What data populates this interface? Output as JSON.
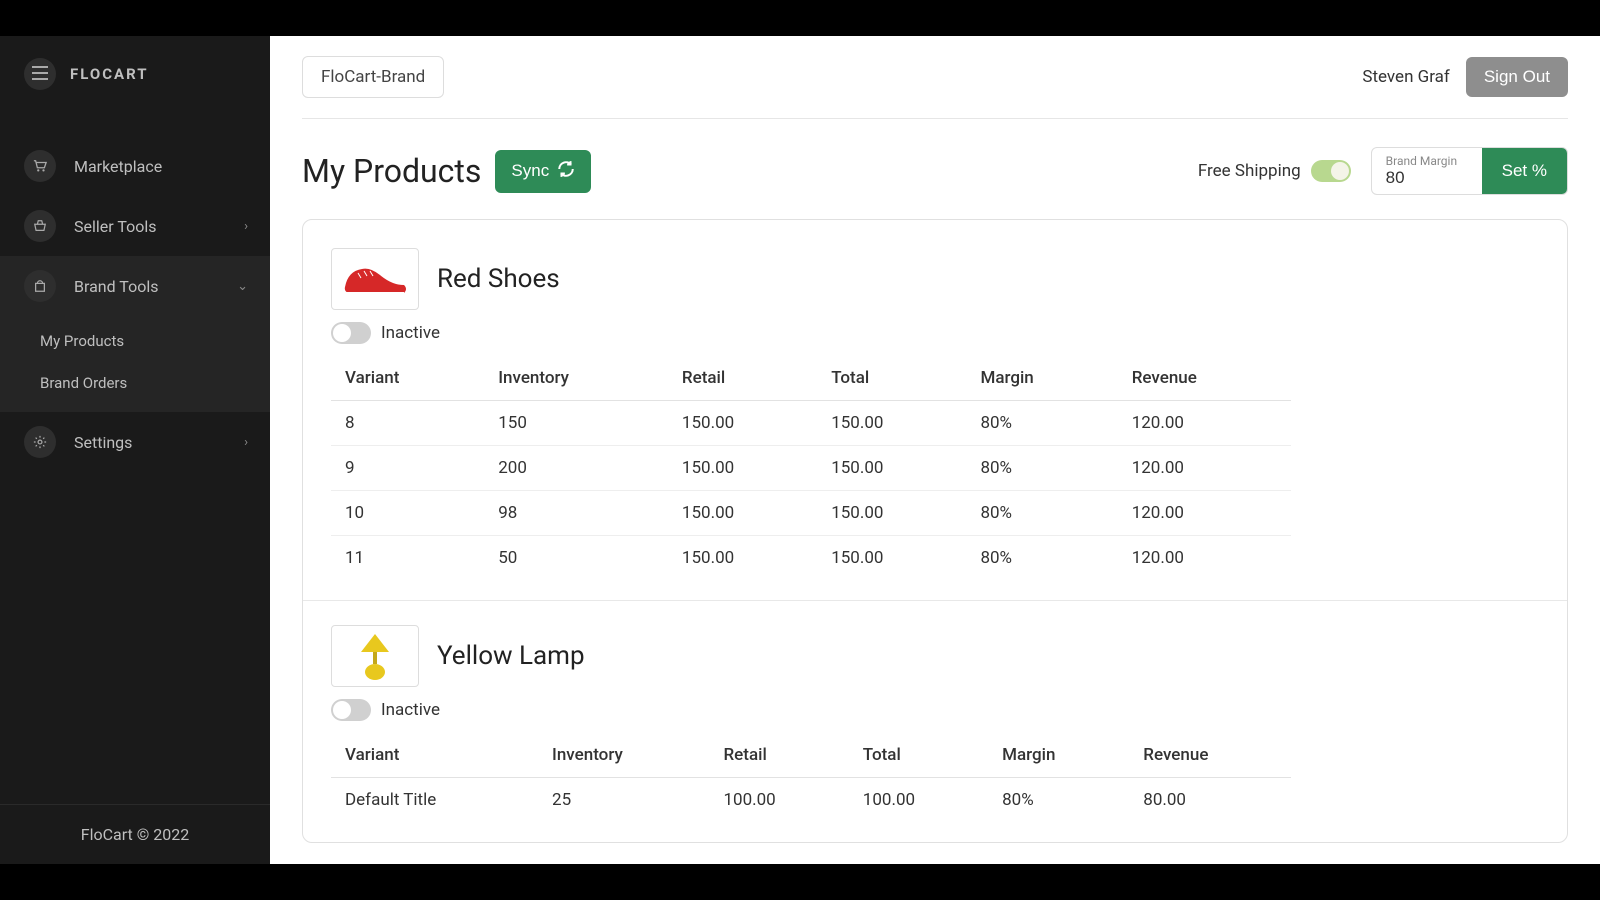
{
  "brand": {
    "name": "FLOCART",
    "footer": "FloCart © 2022"
  },
  "sidebar": {
    "items": [
      {
        "label": "Marketplace",
        "icon": "cart-icon"
      },
      {
        "label": "Seller Tools",
        "icon": "basket-icon"
      },
      {
        "label": "Brand Tools",
        "icon": "bag-icon"
      },
      {
        "label": "Settings",
        "icon": "gear-icon"
      }
    ],
    "brandToolsSub": [
      {
        "label": "My Products"
      },
      {
        "label": "Brand Orders"
      }
    ]
  },
  "topbar": {
    "brandSelector": "FloCart-Brand",
    "userName": "Steven Graf",
    "signOut": "Sign Out"
  },
  "page": {
    "title": "My Products",
    "syncLabel": "Sync",
    "freeShippingLabel": "Free Shipping",
    "freeShippingOn": true,
    "brandMarginLabel": "Brand Margin",
    "brandMarginValue": "80",
    "setLabel": "Set %"
  },
  "columns": [
    "Variant",
    "Inventory",
    "Retail",
    "Total",
    "Margin",
    "Revenue"
  ],
  "products": [
    {
      "name": "Red Shoes",
      "statusLabel": "Inactive",
      "active": false,
      "imgKind": "shoe",
      "imgColor": "#d62828",
      "variants": [
        {
          "variant": "8",
          "inventory": "150",
          "retail": "150.00",
          "total": "150.00",
          "margin": "80%",
          "revenue": "120.00"
        },
        {
          "variant": "9",
          "inventory": "200",
          "retail": "150.00",
          "total": "150.00",
          "margin": "80%",
          "revenue": "120.00"
        },
        {
          "variant": "10",
          "inventory": "98",
          "retail": "150.00",
          "total": "150.00",
          "margin": "80%",
          "revenue": "120.00"
        },
        {
          "variant": "11",
          "inventory": "50",
          "retail": "150.00",
          "total": "150.00",
          "margin": "80%",
          "revenue": "120.00"
        }
      ]
    },
    {
      "name": "Yellow Lamp",
      "statusLabel": "Inactive",
      "active": false,
      "imgKind": "lamp",
      "imgColor": "#e8c81e",
      "variants": [
        {
          "variant": "Default Title",
          "inventory": "25",
          "retail": "100.00",
          "total": "100.00",
          "margin": "80%",
          "revenue": "80.00"
        }
      ]
    }
  ]
}
